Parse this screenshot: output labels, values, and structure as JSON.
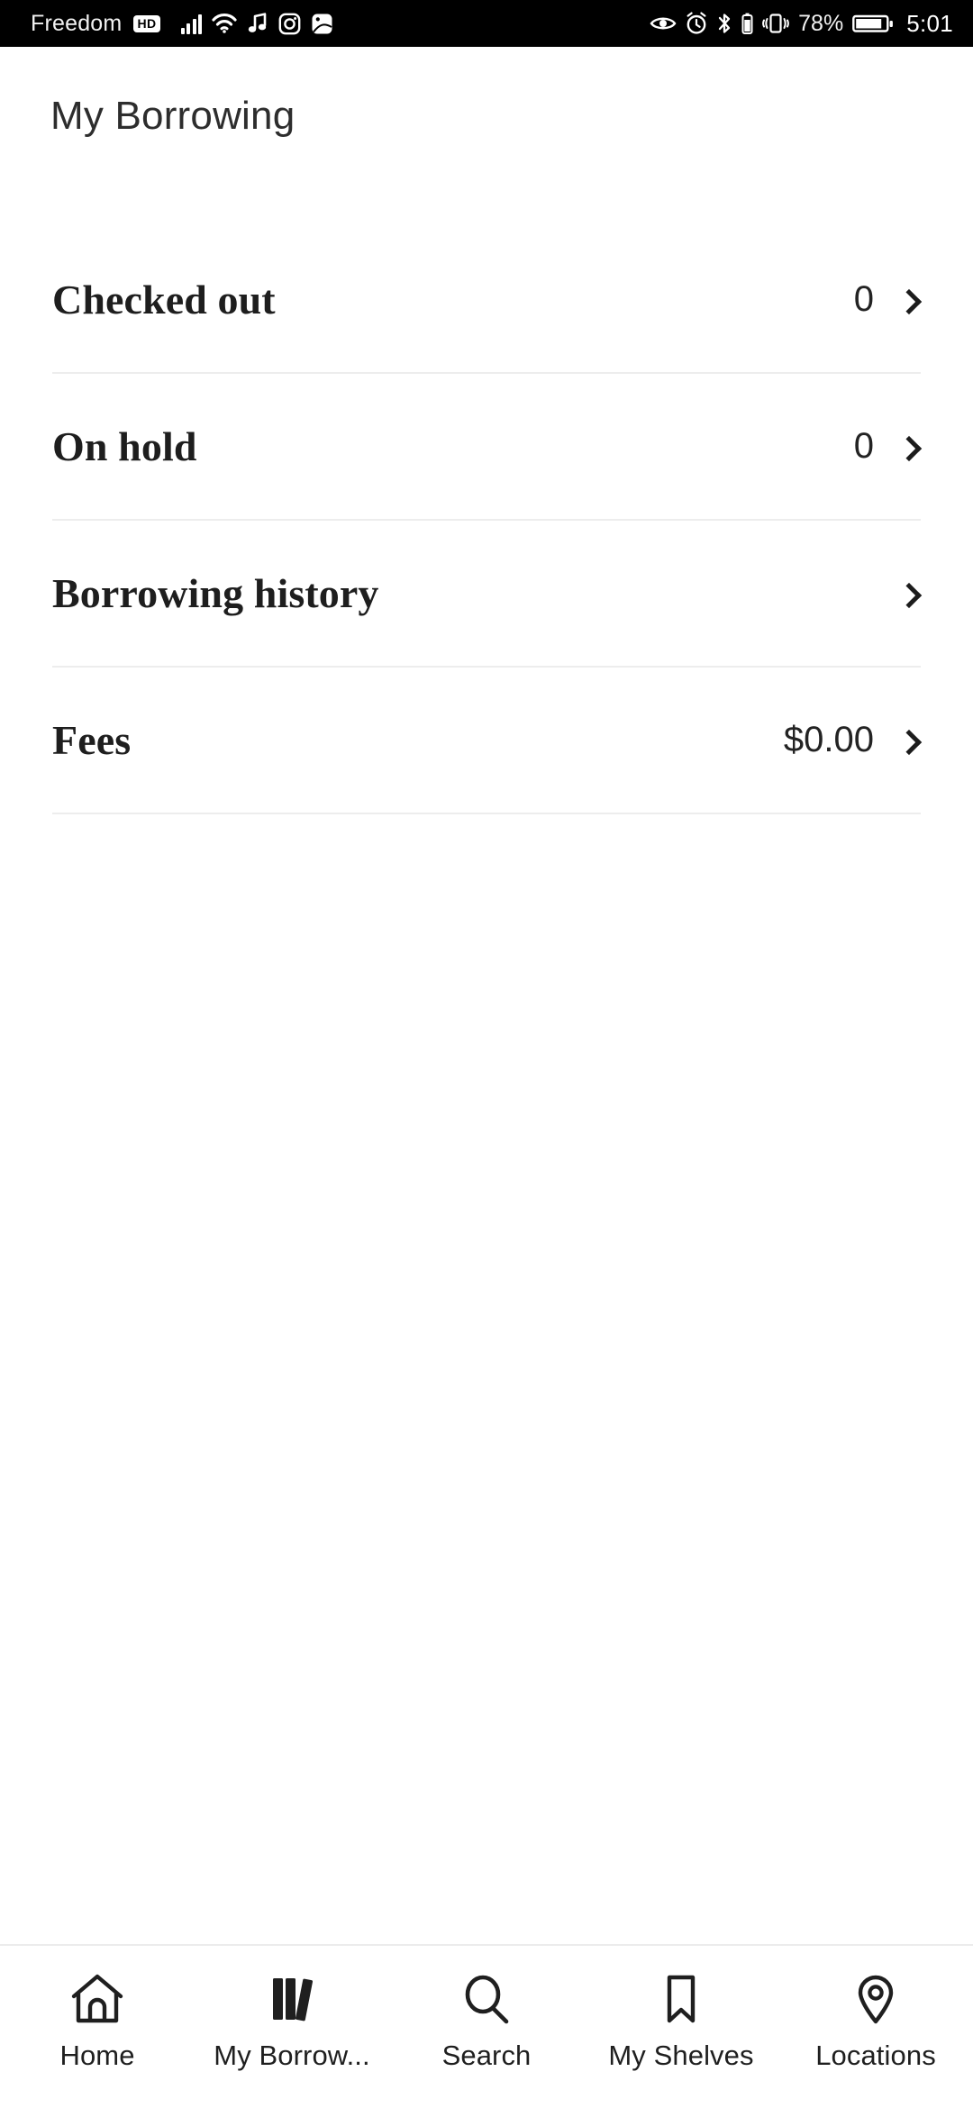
{
  "status_bar": {
    "carrier": "Freedom",
    "hd_badge": "HD",
    "battery_percent": "78%",
    "time": "5:01",
    "icons": [
      "signal-bars-icon",
      "wifi-icon",
      "music-note-icon",
      "instagram-icon",
      "screenshot-icon",
      "eye-icon",
      "alarm-clock-icon",
      "bluetooth-icon",
      "bluetooth-battery-icon",
      "vibrate-icon",
      "battery-icon"
    ]
  },
  "header": {
    "title": "My Borrowing"
  },
  "list": {
    "rows": [
      {
        "label": "Checked out",
        "value": "0"
      },
      {
        "label": "On hold",
        "value": "0"
      },
      {
        "label": "Borrowing history",
        "value": ""
      },
      {
        "label": "Fees",
        "value": "$0.00"
      }
    ]
  },
  "bottom_nav": {
    "active_index": 1,
    "items": [
      {
        "label": "Home",
        "icon": "home-icon"
      },
      {
        "label": "My Borrow...",
        "icon": "books-icon"
      },
      {
        "label": "Search",
        "icon": "search-icon"
      },
      {
        "label": "My Shelves",
        "icon": "bookmark-icon"
      },
      {
        "label": "Locations",
        "icon": "map-pin-icon"
      }
    ]
  },
  "colors": {
    "background": "#ffffff",
    "status_bar_bg": "#000000",
    "title_text": "#2d2d2d",
    "row_text": "#1e1e1e",
    "divider": "#ededed"
  }
}
